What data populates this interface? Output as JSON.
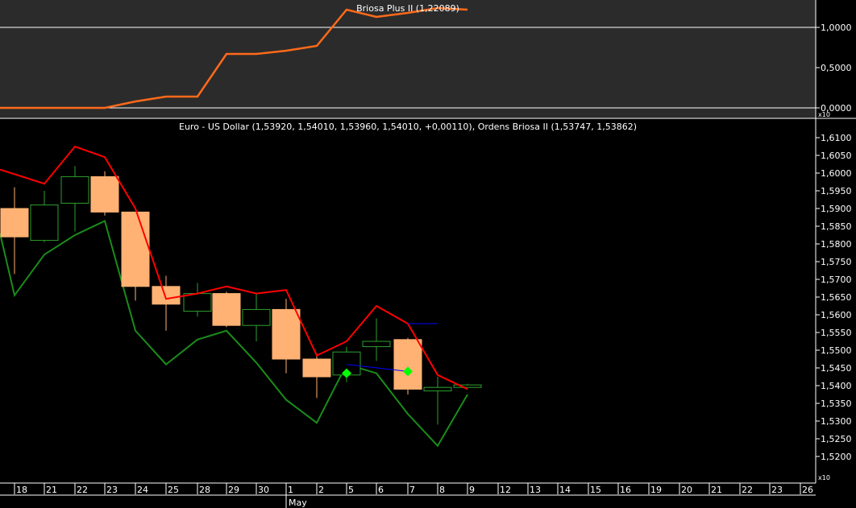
{
  "chart_data": [
    {
      "type": "line",
      "title": "Briosa Plus II (1,22089)",
      "ylim": [
        0,
        1.3
      ],
      "y_ticks": [
        "1,0000",
        "0,5000",
        "0,0000"
      ],
      "y_tick_values": [
        1.0,
        0.5,
        0.0
      ],
      "reference_lines": [
        1.0,
        0.0
      ],
      "series": [
        {
          "color": "#ff6a1a",
          "x": [
            "18",
            "21",
            "22",
            "23",
            "24",
            "25",
            "28",
            "29",
            "30",
            "1",
            "2",
            "5",
            "6",
            "7",
            "8",
            "9"
          ],
          "values": [
            0.0,
            0.0,
            0.0,
            0.0,
            0.08,
            0.14,
            0.14,
            0.67,
            0.67,
            0.71,
            0.77,
            1.22,
            1.13,
            1.18,
            1.24,
            1.22
          ]
        }
      ]
    },
    {
      "type": "candlestick",
      "title": "Euro - US Dollar (1,53920, 1,54010, 1,53960, 1,54010, +0,00110), Ordens Briosa II (1,53747, 1,53862)",
      "ylim": [
        1.517,
        1.614
      ],
      "y_ticks": [
        "1,6100",
        "1,6050",
        "1,6000",
        "1,5950",
        "1,5900",
        "1,5850",
        "1,5800",
        "1,5750",
        "1,5700",
        "1,5650",
        "1,5600",
        "1,5550",
        "1,5500",
        "1,5450",
        "1,5400",
        "1,5350",
        "1,5300",
        "1,5250",
        "1,5200"
      ],
      "y_tick_values": [
        1.61,
        1.605,
        1.6,
        1.595,
        1.59,
        1.585,
        1.58,
        1.575,
        1.57,
        1.565,
        1.56,
        1.555,
        1.55,
        1.545,
        1.54,
        1.535,
        1.53,
        1.525,
        1.52
      ],
      "x_ticks": [
        "18",
        "21",
        "22",
        "23",
        "24",
        "25",
        "28",
        "29",
        "30",
        "1",
        "2",
        "5",
        "6",
        "7",
        "8",
        "9",
        "12",
        "13",
        "14",
        "15",
        "16",
        "19",
        "20",
        "21",
        "22",
        "23",
        "26"
      ],
      "month_label": "May",
      "candles": [
        {
          "x": "18",
          "open": 1.59,
          "high": 1.596,
          "low": 1.5715,
          "close": 1.582
        },
        {
          "x": "21",
          "open": 1.581,
          "high": 1.595,
          "low": 1.5805,
          "close": 1.591
        },
        {
          "x": "22",
          "open": 1.5915,
          "high": 1.602,
          "low": 1.5835,
          "close": 1.599
        },
        {
          "x": "23",
          "open": 1.599,
          "high": 1.6005,
          "low": 1.588,
          "close": 1.589
        },
        {
          "x": "24",
          "open": 1.589,
          "high": 1.589,
          "low": 1.564,
          "close": 1.568
        },
        {
          "x": "25",
          "open": 1.568,
          "high": 1.571,
          "low": 1.5555,
          "close": 1.563
        },
        {
          "x": "28",
          "open": 1.561,
          "high": 1.569,
          "low": 1.5595,
          "close": 1.566
        },
        {
          "x": "29",
          "open": 1.566,
          "high": 1.5665,
          "low": 1.5565,
          "close": 1.557
        },
        {
          "x": "30",
          "open": 1.557,
          "high": 1.566,
          "low": 1.5525,
          "close": 1.5615
        },
        {
          "x": "1",
          "open": 1.5615,
          "high": 1.5645,
          "low": 1.5435,
          "close": 1.5475
        },
        {
          "x": "2",
          "open": 1.5475,
          "high": 1.549,
          "low": 1.5365,
          "close": 1.5425
        },
        {
          "x": "5",
          "open": 1.543,
          "high": 1.551,
          "low": 1.541,
          "close": 1.5495
        },
        {
          "x": "6",
          "open": 1.551,
          "high": 1.559,
          "low": 1.547,
          "close": 1.5525
        },
        {
          "x": "7",
          "open": 1.553,
          "high": 1.5535,
          "low": 1.5375,
          "close": 1.539
        },
        {
          "x": "8",
          "open": 1.5385,
          "high": 1.5425,
          "low": 1.529,
          "close": 1.5395
        },
        {
          "x": "9",
          "open": 1.5395,
          "high": 1.5405,
          "low": 1.5395,
          "close": 1.5402
        }
      ],
      "upper_band": {
        "color": "#ff0000",
        "x": [
          "17",
          "21",
          "22",
          "23",
          "24",
          "25",
          "28",
          "29",
          "30",
          "1",
          "2",
          "5",
          "6",
          "7",
          "8",
          "9"
        ],
        "values": [
          1.601,
          1.597,
          1.6075,
          1.6045,
          1.59,
          1.5645,
          1.566,
          1.568,
          1.566,
          1.567,
          1.5485,
          1.5525,
          1.5625,
          1.5575,
          1.543,
          1.539
        ]
      },
      "lower_band": {
        "color": "#1a8c1a",
        "x": [
          "17",
          "18",
          "21",
          "22",
          "23",
          "24",
          "25",
          "28",
          "29",
          "30",
          "1",
          "2",
          "5",
          "6",
          "7",
          "8",
          "9"
        ],
        "values": [
          1.583,
          1.5655,
          1.577,
          1.5825,
          1.5865,
          1.5555,
          1.546,
          1.553,
          1.5555,
          1.5465,
          1.536,
          1.5295,
          1.546,
          1.5435,
          1.532,
          1.523,
          1.5375
        ]
      },
      "order_lines": [
        {
          "color": "#0000ff",
          "x_from": "5",
          "x_to": "7",
          "y_from": 1.546,
          "y_to": 1.544
        },
        {
          "color": "#0000ff",
          "x_from": "7",
          "x_to": "8",
          "y_from": 1.5575,
          "y_to": 1.5575
        }
      ],
      "markers": [
        {
          "x": "5",
          "y": 1.5435,
          "color": "#00ff00",
          "shape": "diamond"
        },
        {
          "x": "7",
          "y": 1.544,
          "color": "#00ff00",
          "shape": "diamond"
        }
      ]
    }
  ],
  "axis_small_label": "x10",
  "colors": {
    "up_candle_border": "#2ea02e",
    "down_candle_fill": "#ffb273",
    "top_panel_bg": "#2b2b2b"
  }
}
